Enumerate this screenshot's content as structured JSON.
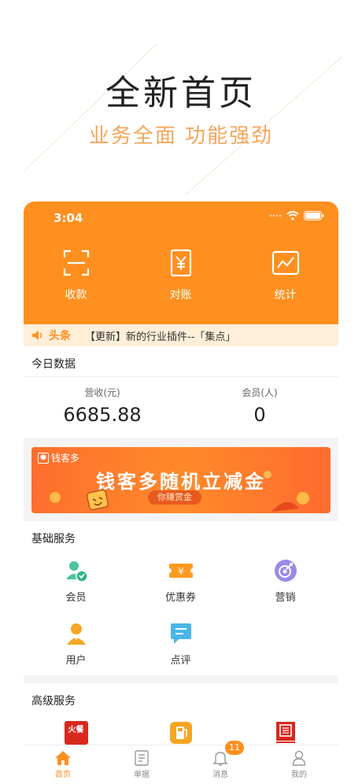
{
  "promo": {
    "title": "全新首页",
    "subtitle": "业务全面  功能强劲"
  },
  "status_bar": {
    "time": "3:04"
  },
  "header_actions": [
    {
      "label": "收款",
      "icon": "scan-icon"
    },
    {
      "label": "对账",
      "icon": "receipt-icon"
    },
    {
      "label": "统计",
      "icon": "chart-icon"
    }
  ],
  "notice": {
    "tag": "头条",
    "text": "【更新】新的行业插件--「集点」"
  },
  "today": {
    "title": "今日数据",
    "revenue_label": "营收(元)",
    "revenue_value": "6685.88",
    "members_label": "会员(人)",
    "members_value": "0"
  },
  "banner": {
    "logo_text": "钱客多",
    "title": "钱客多随机立减金",
    "pill": "你赚赏金"
  },
  "basic_services": {
    "title": "基础服务",
    "items": [
      {
        "label": "会员",
        "icon": "member-icon"
      },
      {
        "label": "优惠券",
        "icon": "coupon-icon"
      },
      {
        "label": "营销",
        "icon": "marketing-icon"
      },
      {
        "label": "用户",
        "icon": "user-icon"
      },
      {
        "label": "点评",
        "icon": "comment-icon"
      }
    ]
  },
  "advanced_services": {
    "title": "高级服务",
    "items": [
      {
        "logo_text": "火餐",
        "icon": "huocan-logo-icon"
      },
      {
        "icon": "fuel-icon"
      },
      {
        "icon": "red-logo-icon"
      }
    ]
  },
  "tabs": [
    {
      "label": "首页",
      "icon": "home-icon",
      "active": true
    },
    {
      "label": "单据",
      "icon": "document-icon"
    },
    {
      "label": "消息",
      "icon": "bell-icon",
      "badge": "11"
    },
    {
      "label": "我的",
      "icon": "person-icon"
    }
  ],
  "colors": {
    "brand": "#FF8F1F",
    "promo_subtitle": "#F5A55A",
    "background": "#F4F4F6"
  }
}
